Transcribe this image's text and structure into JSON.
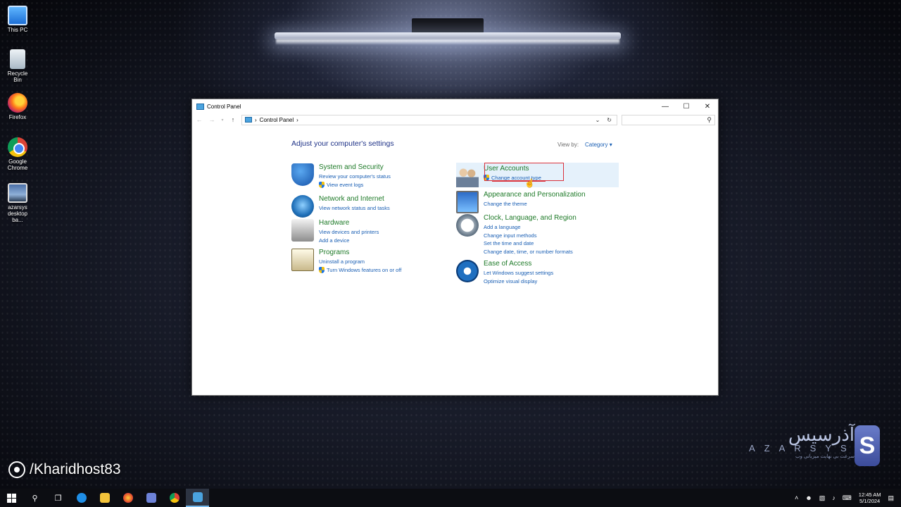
{
  "desktop": {
    "icons": [
      {
        "label": "This PC"
      },
      {
        "label": "Recycle Bin"
      },
      {
        "label": "Firefox"
      },
      {
        "label": "Google Chrome"
      },
      {
        "label": "azarsys desktop ba..."
      }
    ]
  },
  "window": {
    "title": "Control Panel",
    "address": {
      "crumb": "Control Panel",
      "separator": "›"
    },
    "heading": "Adjust your computer's settings",
    "view_by_label": "View by:",
    "view_by_value": "Category",
    "categories_left": [
      {
        "icon": "shield-icon",
        "title": "System and Security",
        "links": [
          "Review your computer's status",
          "View event logs"
        ]
      },
      {
        "icon": "globe-network-icon",
        "title": "Network and Internet",
        "links": [
          "View network status and tasks"
        ]
      },
      {
        "icon": "printer-icon",
        "title": "Hardware",
        "links": [
          "View devices and printers",
          "Add a device"
        ]
      },
      {
        "icon": "programs-icon",
        "title": "Programs",
        "links": [
          "Uninstall a program",
          "Turn Windows features on or off"
        ]
      }
    ],
    "categories_right": [
      {
        "icon": "users-icon",
        "title": "User Accounts",
        "links": [
          "Change account type"
        ]
      },
      {
        "icon": "monitor-palette-icon",
        "title": "Appearance and Personalization",
        "links": [
          "Change the theme"
        ]
      },
      {
        "icon": "clock-globe-icon",
        "title": "Clock, Language, and Region",
        "links": [
          "Add a language",
          "Change input methods",
          "Set the time and date",
          "Change date, time, or number formats"
        ]
      },
      {
        "icon": "ease-of-access-icon",
        "title": "Ease of Access",
        "links": [
          "Let Windows suggest settings",
          "Optimize visual display"
        ]
      }
    ]
  },
  "watermark": {
    "handle": "/Kharidhost83",
    "logo_fa": "آذرسیس",
    "logo_en": "AZARSYS",
    "logo_tag": "سرعت بی نهایت میزبانی وب",
    "logo_mark": "S"
  },
  "taskbar": {
    "time": "12:45 AM",
    "date": "5/1/2024"
  },
  "colors": {
    "link_blue": "#1a5fb4",
    "category_green": "#1e7a28",
    "heading_navy": "#1e3287",
    "highlight": "#e5f1fb",
    "annotation_red": "#d9313b"
  }
}
